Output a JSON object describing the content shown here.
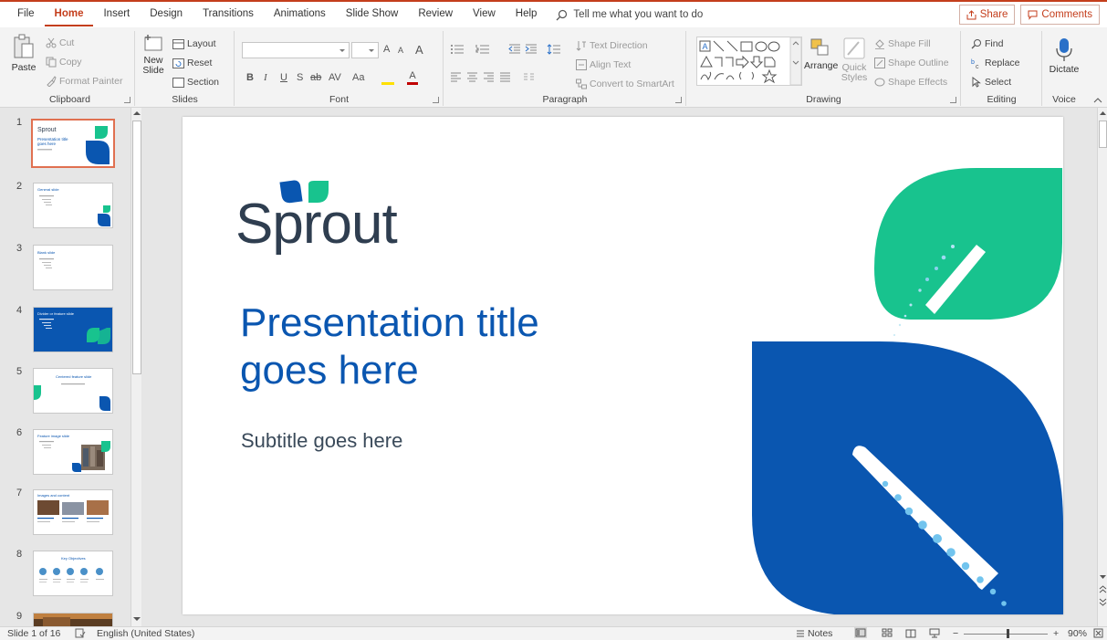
{
  "menu": {
    "tabs": [
      "File",
      "Home",
      "Insert",
      "Design",
      "Transitions",
      "Animations",
      "Slide Show",
      "Review",
      "View",
      "Help"
    ],
    "active": "Home",
    "tell_me": "Tell me what you want to do",
    "share": "Share",
    "comments": "Comments"
  },
  "ribbon": {
    "clipboard": {
      "label": "Clipboard",
      "paste": "Paste",
      "cut": "Cut",
      "copy": "Copy",
      "format_painter": "Format Painter"
    },
    "slides": {
      "label": "Slides",
      "new_slide_1": "New",
      "new_slide_2": "Slide",
      "layout": "Layout",
      "reset": "Reset",
      "section": "Section"
    },
    "font": {
      "label": "Font",
      "bold": "B",
      "italic": "I",
      "underline": "U",
      "shadow": "S",
      "strike": "ab",
      "spacing": "AV",
      "case": "Aa",
      "grow": "A",
      "shrink": "A"
    },
    "paragraph": {
      "label": "Paragraph",
      "text_direction": "Text Direction",
      "align_text": "Align Text",
      "smartart": "Convert to SmartArt"
    },
    "drawing": {
      "label": "Drawing",
      "arrange": "Arrange",
      "quick_styles_1": "Quick",
      "quick_styles_2": "Styles",
      "shape_fill": "Shape Fill",
      "shape_outline": "Shape Outline",
      "shape_effects": "Shape Effects"
    },
    "editing": {
      "label": "Editing",
      "find": "Find",
      "replace": "Replace",
      "select": "Select"
    },
    "voice": {
      "label": "Voice",
      "dictate": "Dictate"
    }
  },
  "thumbnails": [
    {
      "num": "1",
      "title": "Presentation title goes here",
      "kind": "title"
    },
    {
      "num": "2",
      "title": "General slide",
      "kind": "general"
    },
    {
      "num": "3",
      "title": "Blank slide",
      "kind": "blank"
    },
    {
      "num": "4",
      "title": "Divider or feature slide",
      "kind": "divider"
    },
    {
      "num": "5",
      "title": "Centered feature slide",
      "kind": "centered"
    },
    {
      "num": "6",
      "title": "Feature image slide",
      "kind": "image"
    },
    {
      "num": "7",
      "title": "Images and content",
      "kind": "images"
    },
    {
      "num": "8",
      "title": "Key Objectives",
      "kind": "objectives"
    },
    {
      "num": "9",
      "title": "",
      "kind": "photo"
    }
  ],
  "slide": {
    "logo": "Sprout",
    "title_line1": "Presentation title",
    "title_line2": "goes here",
    "subtitle": "Subtitle goes here"
  },
  "status": {
    "slide_of": "Slide 1 of 16",
    "language": "English (United States)",
    "notes": "Notes",
    "zoom": "90%"
  },
  "colors": {
    "accent": "#c43e1c",
    "brand_blue": "#0a56b0",
    "brand_green": "#18c38e",
    "navy": "#2f3e50"
  }
}
